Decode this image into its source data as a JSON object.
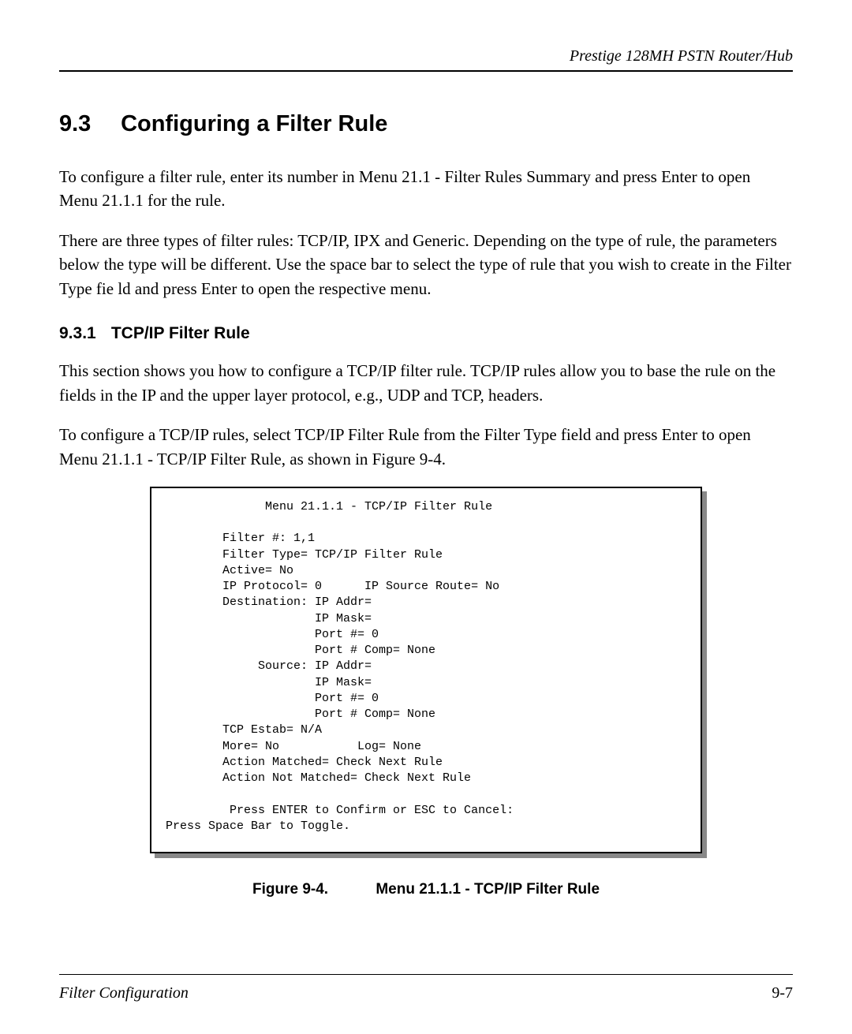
{
  "header": {
    "running_title": "Prestige 128MH  PSTN Router/Hub"
  },
  "section": {
    "number": "9.3",
    "title": "Configuring a Filter Rule"
  },
  "paragraphs": {
    "p1": "To configure a filter rule, enter its number in Menu 21.1 - Filter Rules Summary and press Enter to open Menu 21.1.1 for the rule.",
    "p2": "There are three types of filter rules: TCP/IP, IPX and Generic.  Depending on the type of rule, the parameters below the type will be different.  Use the space bar to select the type of rule that you wish to create in the Filter Type fie ld and press Enter to open the respective menu."
  },
  "subsection": {
    "number": "9.3.1",
    "title": "TCP/IP Filter Rule"
  },
  "sub_paragraphs": {
    "p1": "This section shows you how to configure a TCP/IP filter rule.  TCP/IP rules allow you to base the rule on the fields in the IP and the upper layer protocol, e.g., UDP and TCP, headers.",
    "p2": "To configure a TCP/IP rules, select TCP/IP Filter Rule from the Filter Type field and press Enter to open Menu 21.1.1 - TCP/IP Filter Rule, as shown in Figure 9-4."
  },
  "terminal": {
    "title": "              Menu 21.1.1 - TCP/IP Filter Rule",
    "blank": "",
    "filter_no": "        Filter #: 1,1",
    "filter_type": "        Filter Type= TCP/IP Filter Rule",
    "active": "        Active= No",
    "ip_proto": "        IP Protocol= 0      IP Source Route= No",
    "dest_addr": "        Destination: IP Addr=",
    "dest_mask": "                     IP Mask=",
    "dest_port": "                     Port #= 0",
    "dest_comp": "                     Port # Comp= None",
    "src_addr": "             Source: IP Addr=",
    "src_mask": "                     IP Mask=",
    "src_port": "                     Port #= 0",
    "src_comp": "                     Port # Comp= None",
    "tcp_estab": "        TCP Estab= N/A",
    "more_log": "        More= No           Log= None",
    "action_m": "        Action Matched= Check Next Rule",
    "action_nm": "        Action Not Matched= Check Next Rule",
    "confirm": "         Press ENTER to Confirm or ESC to Cancel:",
    "hint": "Press Space Bar to Toggle."
  },
  "figure": {
    "label": "Figure 9-4.",
    "title": "Menu 21.1.1 - TCP/IP Filter Rule"
  },
  "footer": {
    "left": "Filter Configuration",
    "right": "9-7"
  }
}
